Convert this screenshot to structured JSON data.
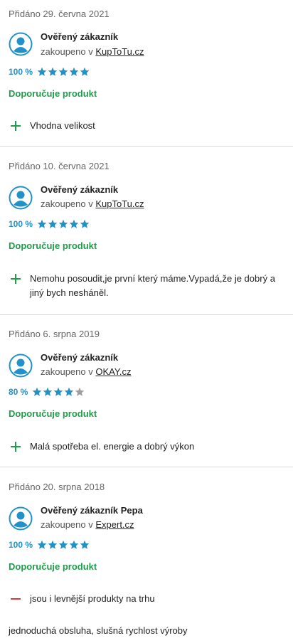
{
  "reviews": [
    {
      "date": "Přidáno 29. června 2021",
      "name": "Ověřený zákazník",
      "bought_prefix": "zakoupeno v",
      "shop": "KupToTu.cz",
      "percent": "100 %",
      "stars": 5,
      "recommend": "Doporučuje produkt",
      "pros": [
        "Vhodna velikost"
      ]
    },
    {
      "date": "Přidáno 10. června 2021",
      "name": "Ověřený zákazník",
      "bought_prefix": "zakoupeno v",
      "shop": "KupToTu.cz",
      "percent": "100 %",
      "stars": 5,
      "recommend": "Doporučuje produkt",
      "pros": [
        "Nemohu posoudit,je první který máme.Vypadá,že je dobrý a jiný bych nesháněl."
      ]
    },
    {
      "date": "Přidáno 6. srpna 2019",
      "name": "Ověřený zákazník",
      "bought_prefix": "zakoupeno v",
      "shop": "OKAY.cz",
      "percent": "80 %",
      "stars": 4,
      "recommend": "Doporučuje produkt",
      "pros": [
        "Malá spotřeba el. energie a dobrý výkon"
      ]
    },
    {
      "date": "Přidáno 20. srpna 2018",
      "name": "Ověřený zákazník Pepa",
      "bought_prefix": "zakoupeno v",
      "shop": "Expert.cz",
      "percent": "100 %",
      "stars": 5,
      "recommend": "Doporučuje produkt",
      "cons": [
        "jsou i levnější produkty na trhu"
      ],
      "comment": "jednoduchá obsluha, slušná rychlost výroby"
    }
  ],
  "colors": {
    "star_filled": "#2191c8",
    "star_empty": "#9e9e9e",
    "recommend": "#1f9e4a",
    "plus": "#1f9e4a",
    "minus": "#e03a3a",
    "avatar": "#2191c8"
  },
  "icons": {
    "avatar": "user-avatar-icon",
    "star": "star-icon",
    "plus": "plus-icon",
    "minus": "minus-icon"
  }
}
